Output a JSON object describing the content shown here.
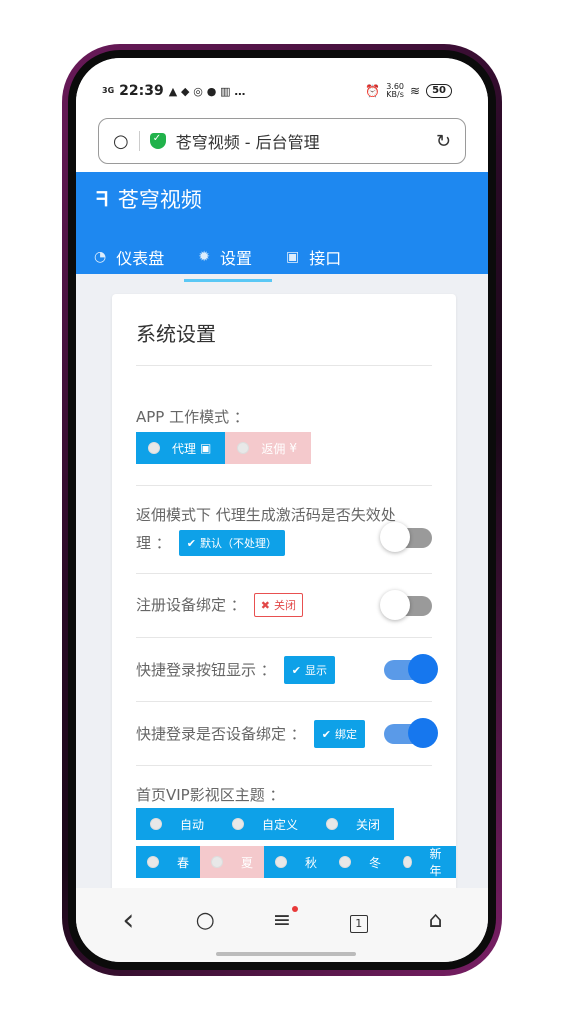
{
  "status_bar": {
    "network": "3G",
    "time": "22:39",
    "notif_icons": "▲ ◆ ◎ ● ▥ …",
    "speed_top": "3.60",
    "speed_bottom": "KB/s",
    "battery": "50"
  },
  "url_bar": {
    "title": "苍穹视频 - 后台管理"
  },
  "app": {
    "brand": "苍穹视频",
    "nav": [
      {
        "label": "仪表盘",
        "icon": "dashboard-icon"
      },
      {
        "label": "设置",
        "icon": "gear-icon"
      },
      {
        "label": "接口",
        "icon": "api-icon"
      }
    ],
    "active_tab": "设置"
  },
  "card": {
    "title": "系统设置",
    "app_mode": {
      "label": "APP 工作模式 ：",
      "options": [
        {
          "label": "代理",
          "selected": true
        },
        {
          "label": "返佣",
          "selected": false
        }
      ]
    },
    "rebate_handling": {
      "label_line1": "返佣模式下 代理生成激活码是否失效处",
      "label_line2": "理 ：",
      "badge": "默认（不处理）",
      "toggle": false
    },
    "device_binding": {
      "label": "注册设备绑定 ：",
      "badge": "关闭",
      "toggle": false
    },
    "quick_login_show": {
      "label": "快捷登录按钮显示 ：",
      "badge": "显示",
      "toggle": true
    },
    "quick_login_bind": {
      "label": "快捷登录是否设备绑定 ：",
      "badge": "绑定",
      "toggle": true
    },
    "vip_theme": {
      "label": "首页VIP影视区主题 ：",
      "row1": [
        {
          "label": "自动"
        },
        {
          "label": "自定义"
        },
        {
          "label": "关闭"
        }
      ],
      "row2": [
        {
          "label": "春"
        },
        {
          "label": "夏",
          "dim": true
        },
        {
          "label": "秋"
        },
        {
          "label": "冬"
        },
        {
          "label": "新年"
        }
      ]
    }
  },
  "bottom_nav": {
    "back": "‹",
    "search": "○",
    "menu": "≡",
    "tabs_count": "1",
    "home": "⌂"
  },
  "colors": {
    "primary": "#1e88f0",
    "button_blue": "#0ea1e8",
    "danger": "#e24848",
    "dim_option": "#f4c9cc"
  }
}
